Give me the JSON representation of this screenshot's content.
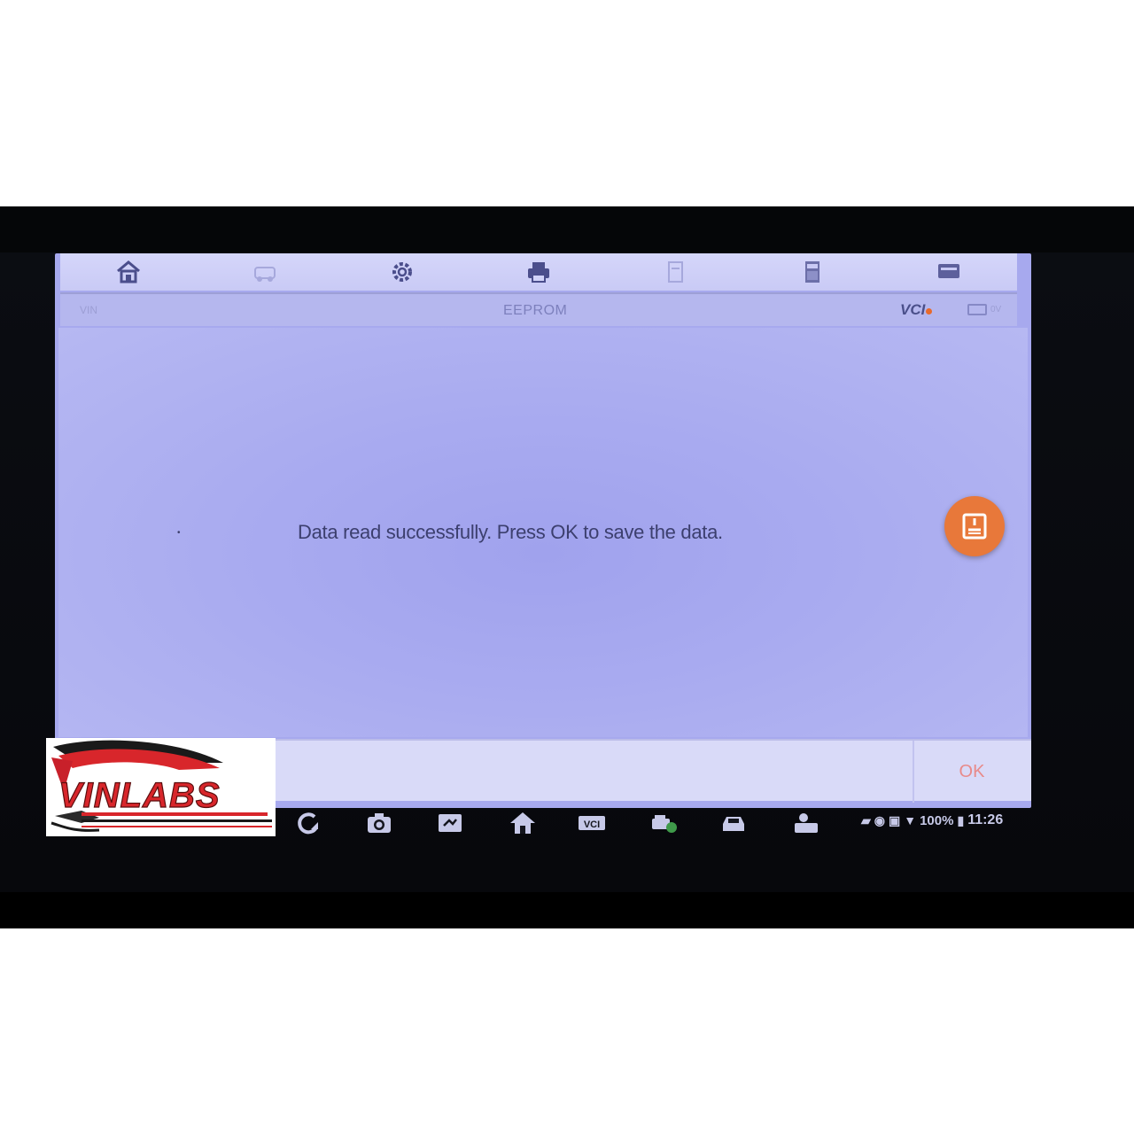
{
  "toolbar": {
    "icons": [
      "home-icon",
      "vehicle-icon",
      "gear-icon",
      "printer-icon",
      "document-icon",
      "calculator-icon",
      "keyboard-icon"
    ]
  },
  "titlebar": {
    "vin_label": "VIN",
    "title": "EEPROM",
    "vci_label": "VCI",
    "battery_text": "0V"
  },
  "message": {
    "bullet": "•",
    "text": "Data read successfully. Press OK to save the data."
  },
  "fab": {
    "icon": "save-icon",
    "color": "#e8783a"
  },
  "footer": {
    "ok_label": "OK"
  },
  "navbar": {
    "icons": [
      "recents-icon",
      "camera-icon",
      "screenshot-icon",
      "home-icon",
      "vci-icon",
      "vehicle-scan-icon",
      "car-icon",
      "tpms-icon"
    ],
    "status": {
      "battery_percent": "100%",
      "time": "11:26"
    }
  },
  "watermark": {
    "brand": "VINLABS"
  }
}
